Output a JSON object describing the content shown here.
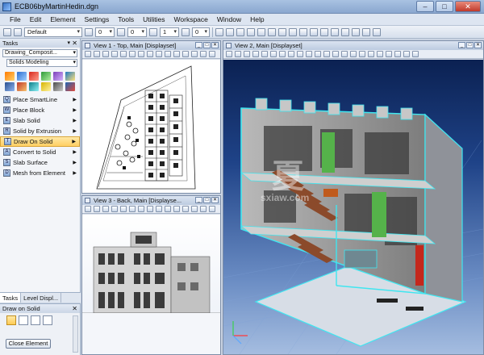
{
  "window": {
    "title": "ECB06byMartinHedin.dgn",
    "minimize": "–",
    "maximize": "□",
    "close": "✕"
  },
  "menu": [
    "File",
    "Edit",
    "Element",
    "Settings",
    "Tools",
    "Utilities",
    "Workspace",
    "Window",
    "Help"
  ],
  "toolbar": {
    "level_value": "Default",
    "color_value": "0",
    "style_value": "0",
    "weight_value": "1",
    "transparency_value": "0"
  },
  "tasks": {
    "title": "Tasks",
    "category_combo": "Drawing_Composit...",
    "subcategory_combo": "Solids Modeling",
    "items": [
      {
        "key": "Q",
        "label": "Place SmartLine"
      },
      {
        "key": "W",
        "label": "Place Block"
      },
      {
        "key": "E",
        "label": "Slab Solid"
      },
      {
        "key": "R",
        "label": "Solid by Extrusion"
      },
      {
        "key": "T",
        "label": "Draw On Solid"
      },
      {
        "key": "A",
        "label": "Convert to Solid"
      },
      {
        "key": "S",
        "label": "Slab Surface"
      },
      {
        "key": "D",
        "label": "Mesh from Element"
      }
    ],
    "tabs": [
      "Tasks",
      "Level Displ..."
    ]
  },
  "tool_settings": {
    "title": "Draw on Solid",
    "close_button": "Close Element"
  },
  "views": {
    "view1": "View 1 - Top, Main [Displayset]",
    "view2": "View 2, Main [Displayset]",
    "view3": "View 3 - Back, Main [Displayse..."
  },
  "watermark": {
    "big": "夏",
    "small": "sxiaw.com"
  },
  "colors": {
    "accent_title": "#8aa7cf",
    "active_task": "#ffcf62",
    "view2_bg": "#1f4388",
    "cyan_outline": "#3fe6f0"
  }
}
